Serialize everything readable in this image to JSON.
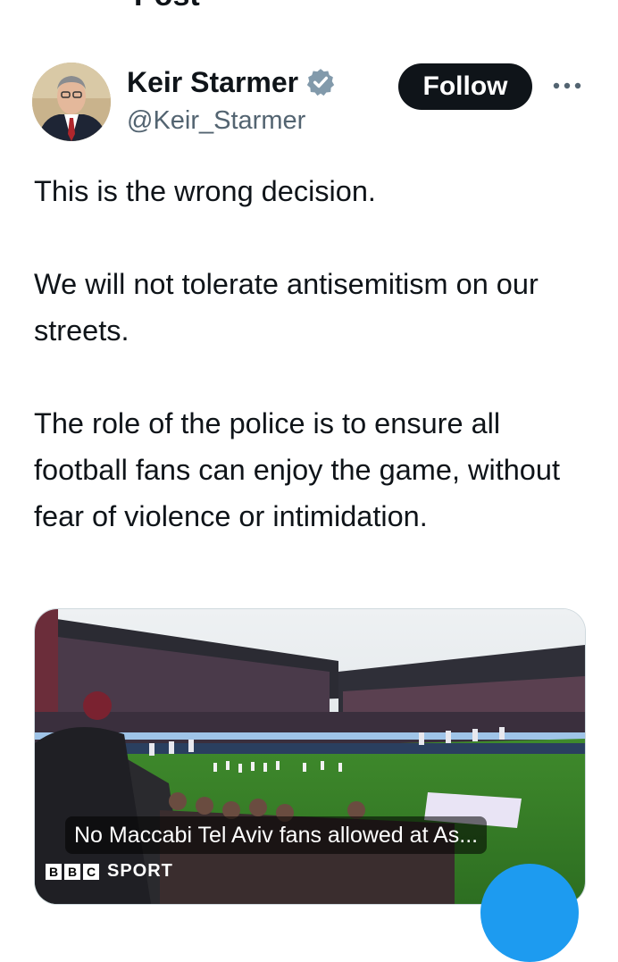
{
  "header": {
    "title": "Post",
    "back_icon": "arrow-left-icon"
  },
  "post": {
    "author": {
      "display_name": "Keir Starmer",
      "handle": "@Keir_Starmer",
      "verified_icon": "verified-badge-icon",
      "verified_color": "#829aab"
    },
    "follow_label": "Follow",
    "more_icon": "more-horizontal-icon",
    "text": {
      "p1": "This is the wrong decision.",
      "p2": "We will not tolerate antisemitism on our streets.",
      "p3": "The role of the police is to ensure all football fans can enjoy the game, without fear of violence or intimidation."
    },
    "link_card": {
      "caption": "No Maccabi Tel Aviv fans allowed at As...",
      "source": {
        "letters": [
          "B",
          "B",
          "C"
        ],
        "word": "SPORT"
      }
    }
  },
  "colors": {
    "accent": "#1d9bf0",
    "text": "#0f1419",
    "secondary": "#536471",
    "button": "#0f1419"
  }
}
